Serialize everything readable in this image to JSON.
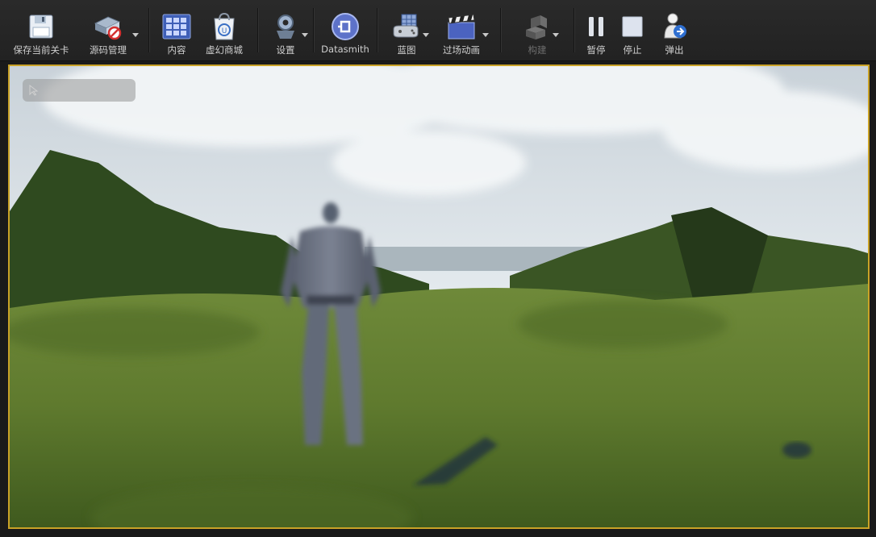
{
  "toolbar": {
    "items": [
      {
        "label": "保存当前关卡",
        "icon": "save-icon"
      },
      {
        "label": "源码管理",
        "icon": "source-control-icon",
        "dropdown": true
      },
      {
        "label": "内容",
        "icon": "content-browser-icon"
      },
      {
        "label": "虚幻商城",
        "icon": "marketplace-icon"
      },
      {
        "label": "设置",
        "icon": "settings-icon",
        "dropdown": true
      },
      {
        "label": "Datasmith",
        "icon": "datasmith-icon"
      },
      {
        "label": "蓝图",
        "icon": "blueprint-icon",
        "dropdown": true
      },
      {
        "label": "过场动画",
        "icon": "cinematics-icon",
        "dropdown": true
      },
      {
        "label": "构建",
        "icon": "build-icon",
        "dropdown": true,
        "disabled": true
      },
      {
        "label": "暂停",
        "icon": "pause-icon"
      },
      {
        "label": "停止",
        "icon": "stop-icon"
      },
      {
        "label": "弹出",
        "icon": "eject-icon"
      }
    ]
  },
  "viewport": {
    "accent_color": "#c9a227",
    "scene": "third-person game view: grey mannequin character running on green hilly terrain under cloudy sky"
  }
}
